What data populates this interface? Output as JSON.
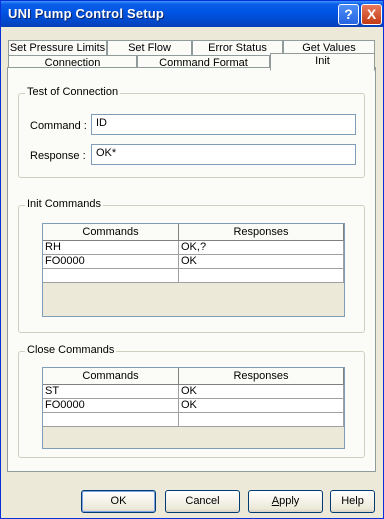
{
  "window": {
    "title": "UNI Pump Control Setup",
    "help_glyph": "?",
    "close_glyph": "X"
  },
  "tabs": {
    "row1": [
      "Set Pressure Limits",
      "Set Flow",
      "Error Status",
      "Get Values"
    ],
    "row2": [
      "Connection",
      "Command Format",
      "Init"
    ],
    "active": "Init"
  },
  "test_connection": {
    "title": "Test of Connection",
    "command_label": "Command :",
    "command_value": "ID",
    "response_label": "Response :",
    "response_value": "OK*"
  },
  "init_commands": {
    "title": "Init Commands",
    "columns": [
      "Commands",
      "Responses"
    ],
    "rows": [
      [
        "RH",
        "OK,?"
      ],
      [
        "FO0000",
        "OK"
      ],
      [
        "",
        ""
      ]
    ]
  },
  "close_commands": {
    "title": "Close Commands",
    "columns": [
      "Commands",
      "Responses"
    ],
    "rows": [
      [
        "ST",
        "OK"
      ],
      [
        "FO0000",
        "OK"
      ],
      [
        "",
        ""
      ]
    ]
  },
  "buttons": {
    "ok": "OK",
    "cancel": "Cancel",
    "apply_a": "A",
    "apply_rest": "pply",
    "help": "Help"
  }
}
